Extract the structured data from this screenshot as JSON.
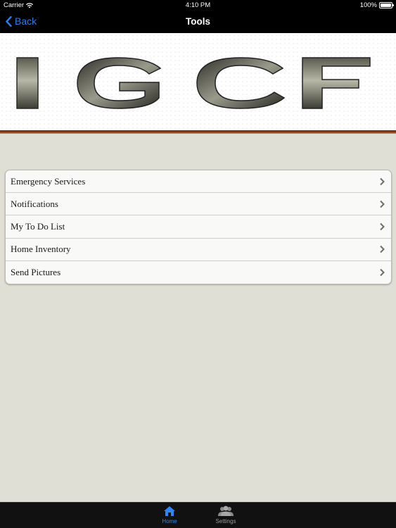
{
  "status_bar": {
    "carrier": "Carrier",
    "time": "4:10 PM",
    "battery": "100%"
  },
  "nav": {
    "back_label": "Back",
    "title": "Tools"
  },
  "banner": {
    "logo_text": "IGCF"
  },
  "menu": {
    "items": [
      {
        "label": "Emergency Services"
      },
      {
        "label": "Notifications"
      },
      {
        "label": "My To Do List"
      },
      {
        "label": "Home Inventory"
      },
      {
        "label": "Send Pictures"
      }
    ]
  },
  "tabs": [
    {
      "label": "Home",
      "icon": "home-icon",
      "active": true
    },
    {
      "label": "Settings",
      "icon": "people-icon",
      "active": false
    }
  ],
  "colors": {
    "accent": "#2f86f0",
    "banner_rule": "#7a3514",
    "background": "#e0dfd6"
  }
}
